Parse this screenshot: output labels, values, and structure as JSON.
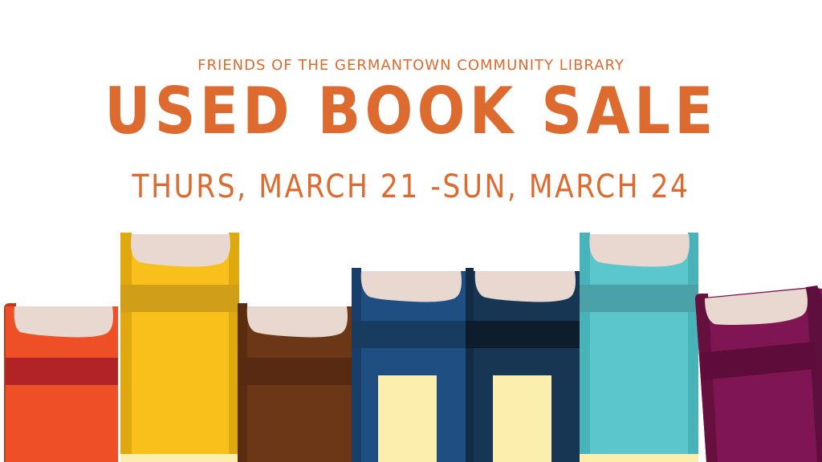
{
  "banner": {
    "organization": "FRIENDS OF THE GERMANTOWN COMMUNITY LIBRARY",
    "headline": "USED BOOK SALE",
    "dates": "THURS, MARCH 21 -SUN, MARCH 24"
  },
  "colors": {
    "text": "#dd6a2e",
    "background": "#ffffff",
    "pages": "#e9d8cf",
    "book_red": "#ef4f26",
    "book_yellow": "#f9bf1b",
    "book_brown": "#6c3716",
    "book_blue": "#1f4e82",
    "book_navy": "#173654",
    "book_teal": "#5cc6cd",
    "book_purple": "#7f1553",
    "label_cream": "#fcefad"
  }
}
